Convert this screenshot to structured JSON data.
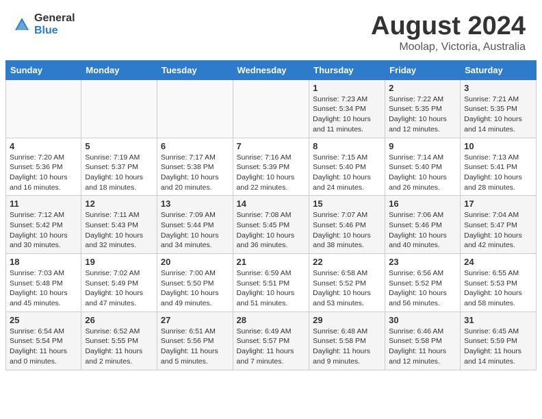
{
  "header": {
    "logo_general": "General",
    "logo_blue": "Blue",
    "month_title": "August 2024",
    "location": "Moolap, Victoria, Australia"
  },
  "days_of_week": [
    "Sunday",
    "Monday",
    "Tuesday",
    "Wednesday",
    "Thursday",
    "Friday",
    "Saturday"
  ],
  "weeks": [
    [
      {
        "day": "",
        "info": ""
      },
      {
        "day": "",
        "info": ""
      },
      {
        "day": "",
        "info": ""
      },
      {
        "day": "",
        "info": ""
      },
      {
        "day": "1",
        "info": "Sunrise: 7:23 AM\nSunset: 5:34 PM\nDaylight: 10 hours\nand 11 minutes."
      },
      {
        "day": "2",
        "info": "Sunrise: 7:22 AM\nSunset: 5:35 PM\nDaylight: 10 hours\nand 12 minutes."
      },
      {
        "day": "3",
        "info": "Sunrise: 7:21 AM\nSunset: 5:35 PM\nDaylight: 10 hours\nand 14 minutes."
      }
    ],
    [
      {
        "day": "4",
        "info": "Sunrise: 7:20 AM\nSunset: 5:36 PM\nDaylight: 10 hours\nand 16 minutes."
      },
      {
        "day": "5",
        "info": "Sunrise: 7:19 AM\nSunset: 5:37 PM\nDaylight: 10 hours\nand 18 minutes."
      },
      {
        "day": "6",
        "info": "Sunrise: 7:17 AM\nSunset: 5:38 PM\nDaylight: 10 hours\nand 20 minutes."
      },
      {
        "day": "7",
        "info": "Sunrise: 7:16 AM\nSunset: 5:39 PM\nDaylight: 10 hours\nand 22 minutes."
      },
      {
        "day": "8",
        "info": "Sunrise: 7:15 AM\nSunset: 5:40 PM\nDaylight: 10 hours\nand 24 minutes."
      },
      {
        "day": "9",
        "info": "Sunrise: 7:14 AM\nSunset: 5:40 PM\nDaylight: 10 hours\nand 26 minutes."
      },
      {
        "day": "10",
        "info": "Sunrise: 7:13 AM\nSunset: 5:41 PM\nDaylight: 10 hours\nand 28 minutes."
      }
    ],
    [
      {
        "day": "11",
        "info": "Sunrise: 7:12 AM\nSunset: 5:42 PM\nDaylight: 10 hours\nand 30 minutes."
      },
      {
        "day": "12",
        "info": "Sunrise: 7:11 AM\nSunset: 5:43 PM\nDaylight: 10 hours\nand 32 minutes."
      },
      {
        "day": "13",
        "info": "Sunrise: 7:09 AM\nSunset: 5:44 PM\nDaylight: 10 hours\nand 34 minutes."
      },
      {
        "day": "14",
        "info": "Sunrise: 7:08 AM\nSunset: 5:45 PM\nDaylight: 10 hours\nand 36 minutes."
      },
      {
        "day": "15",
        "info": "Sunrise: 7:07 AM\nSunset: 5:46 PM\nDaylight: 10 hours\nand 38 minutes."
      },
      {
        "day": "16",
        "info": "Sunrise: 7:06 AM\nSunset: 5:46 PM\nDaylight: 10 hours\nand 40 minutes."
      },
      {
        "day": "17",
        "info": "Sunrise: 7:04 AM\nSunset: 5:47 PM\nDaylight: 10 hours\nand 42 minutes."
      }
    ],
    [
      {
        "day": "18",
        "info": "Sunrise: 7:03 AM\nSunset: 5:48 PM\nDaylight: 10 hours\nand 45 minutes."
      },
      {
        "day": "19",
        "info": "Sunrise: 7:02 AM\nSunset: 5:49 PM\nDaylight: 10 hours\nand 47 minutes."
      },
      {
        "day": "20",
        "info": "Sunrise: 7:00 AM\nSunset: 5:50 PM\nDaylight: 10 hours\nand 49 minutes."
      },
      {
        "day": "21",
        "info": "Sunrise: 6:59 AM\nSunset: 5:51 PM\nDaylight: 10 hours\nand 51 minutes."
      },
      {
        "day": "22",
        "info": "Sunrise: 6:58 AM\nSunset: 5:52 PM\nDaylight: 10 hours\nand 53 minutes."
      },
      {
        "day": "23",
        "info": "Sunrise: 6:56 AM\nSunset: 5:52 PM\nDaylight: 10 hours\nand 56 minutes."
      },
      {
        "day": "24",
        "info": "Sunrise: 6:55 AM\nSunset: 5:53 PM\nDaylight: 10 hours\nand 58 minutes."
      }
    ],
    [
      {
        "day": "25",
        "info": "Sunrise: 6:54 AM\nSunset: 5:54 PM\nDaylight: 11 hours\nand 0 minutes."
      },
      {
        "day": "26",
        "info": "Sunrise: 6:52 AM\nSunset: 5:55 PM\nDaylight: 11 hours\nand 2 minutes."
      },
      {
        "day": "27",
        "info": "Sunrise: 6:51 AM\nSunset: 5:56 PM\nDaylight: 11 hours\nand 5 minutes."
      },
      {
        "day": "28",
        "info": "Sunrise: 6:49 AM\nSunset: 5:57 PM\nDaylight: 11 hours\nand 7 minutes."
      },
      {
        "day": "29",
        "info": "Sunrise: 6:48 AM\nSunset: 5:58 PM\nDaylight: 11 hours\nand 9 minutes."
      },
      {
        "day": "30",
        "info": "Sunrise: 6:46 AM\nSunset: 5:58 PM\nDaylight: 11 hours\nand 12 minutes."
      },
      {
        "day": "31",
        "info": "Sunrise: 6:45 AM\nSunset: 5:59 PM\nDaylight: 11 hours\nand 14 minutes."
      }
    ]
  ]
}
